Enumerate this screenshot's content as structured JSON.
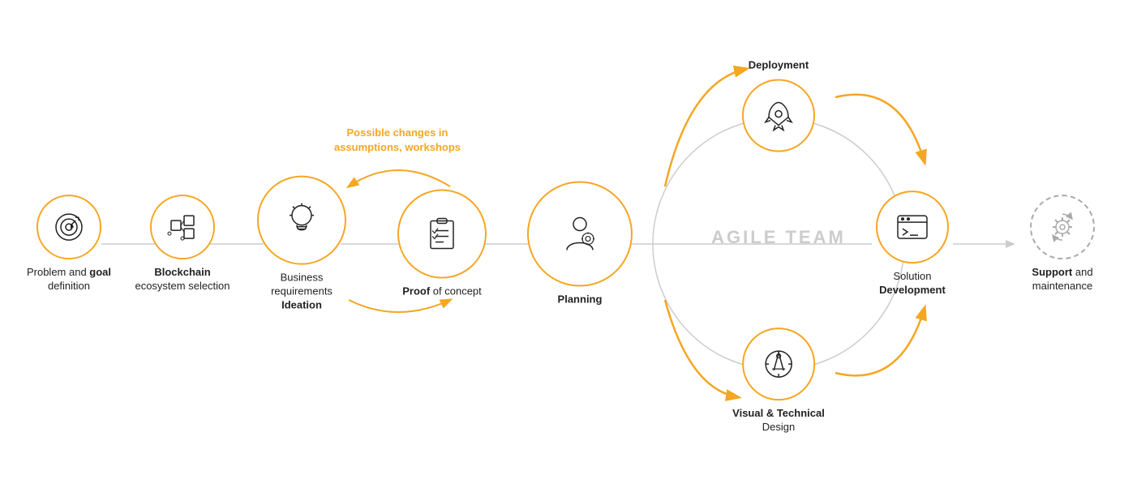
{
  "nodes": {
    "problem": {
      "label_line1": "Problem and",
      "label_line2": "goal",
      "label_line3": "definition",
      "icon": "🎯"
    },
    "blockchain": {
      "label_line1": "Blockchain",
      "label_line2": "ecosystem",
      "label_line3": "selection",
      "bold_line": "Blockchain"
    },
    "business": {
      "label_line1": "Business",
      "label_line2": "requirements",
      "label_line3": "Ideation",
      "bold_line": "Ideation"
    },
    "proof": {
      "label_line1": "Proof",
      "label_line2": "of concept",
      "bold_line": "Proof"
    },
    "planning": {
      "label_line1": "Planning",
      "bold_line": "Planning"
    },
    "deployment": {
      "label_line1": "Deployment"
    },
    "visual": {
      "label_line1": "Visual & Technical",
      "label_line2": "Design"
    },
    "solution": {
      "label_line1": "Solution",
      "label_line2": "Development"
    },
    "support": {
      "label_line1": "Support",
      "label_line2": "and maintenance",
      "bold_line": "Support"
    }
  },
  "possible_changes": {
    "line1": "Possible changes in",
    "line2": "assumptions, workshops"
  },
  "agile_team": "AGILE TEAM",
  "colors": {
    "orange": "#F5A623",
    "gray_dashed": "#aaa",
    "line": "#ccc",
    "text": "#222"
  }
}
